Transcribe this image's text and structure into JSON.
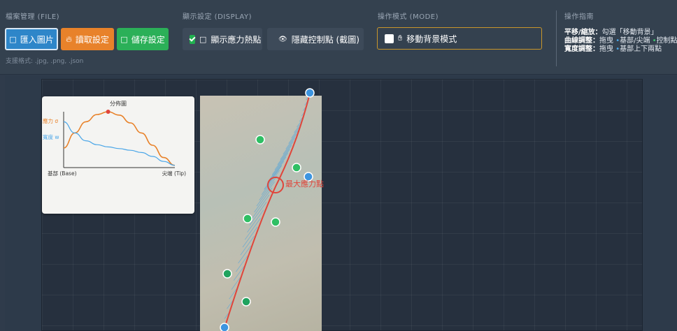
{
  "toolbar": {
    "file_group": {
      "label": "檔案管理 (FILE)",
      "import_label": "匯入圖片",
      "load_label": "讀取設定",
      "save_label": "儲存設定",
      "formats": "支援格式: .jpg, .png, .json"
    },
    "display_group": {
      "label": "顯示設定 (DISPLAY)",
      "heatmap_label": "顯示應力熱點",
      "heatmap_checked": true,
      "hide_points_label": "隱藏控制點 (截圖)",
      "hide_points_checked": false
    },
    "mode_group": {
      "label": "操作模式 (MODE)",
      "move_bg_label": "移動背景模式",
      "move_bg_checked": false
    },
    "guide_group": {
      "label": "操作指南",
      "line1_title": "平移/縮放：",
      "line1_text": "勾選「移動背景」",
      "line2_title": "曲線調整：",
      "line2_text_a": "拖曳 ",
      "line2_text_b": "基部/尖端 ",
      "line2_text_c": "控制點",
      "line3_title": "寬度調整：",
      "line3_text_a": "拖曳 ",
      "line3_text_b": "基部上下兩點"
    }
  },
  "colors": {
    "accent_blue": "#2e86c9",
    "accent_orange": "#e8822a",
    "accent_green": "#2bb058",
    "stress_curve": "#e8822a",
    "width_curve": "#4aa6e8",
    "centerline": "#e0453a",
    "control_green": "#2fbf64",
    "control_blue": "#3d95e0"
  },
  "canvas": {
    "max_stress_label": "最大應力點"
  },
  "chart_data": {
    "type": "line",
    "title": "分佈圖",
    "xlabel_left": "基部 (Base)",
    "xlabel_right": "尖端 (Tip)",
    "series": [
      {
        "name": "應力 σ",
        "color": "#e8822a",
        "x": [
          0,
          0.1,
          0.2,
          0.3,
          0.4,
          0.5,
          0.6,
          0.7,
          0.8,
          0.9,
          1.0
        ],
        "values": [
          0.35,
          0.62,
          0.82,
          0.95,
          1.0,
          0.94,
          0.8,
          0.62,
          0.4,
          0.18,
          0.04
        ]
      },
      {
        "name": "寬度 w",
        "color": "#4aa6e8",
        "x": [
          0,
          0.1,
          0.2,
          0.3,
          0.4,
          0.5,
          0.6,
          0.7,
          0.8,
          0.9,
          1.0
        ],
        "values": [
          0.82,
          0.62,
          0.48,
          0.41,
          0.37,
          0.34,
          0.31,
          0.27,
          0.2,
          0.11,
          0.04
        ]
      }
    ],
    "peak_marker_series": "應力 σ",
    "peak_x": 0.4
  }
}
